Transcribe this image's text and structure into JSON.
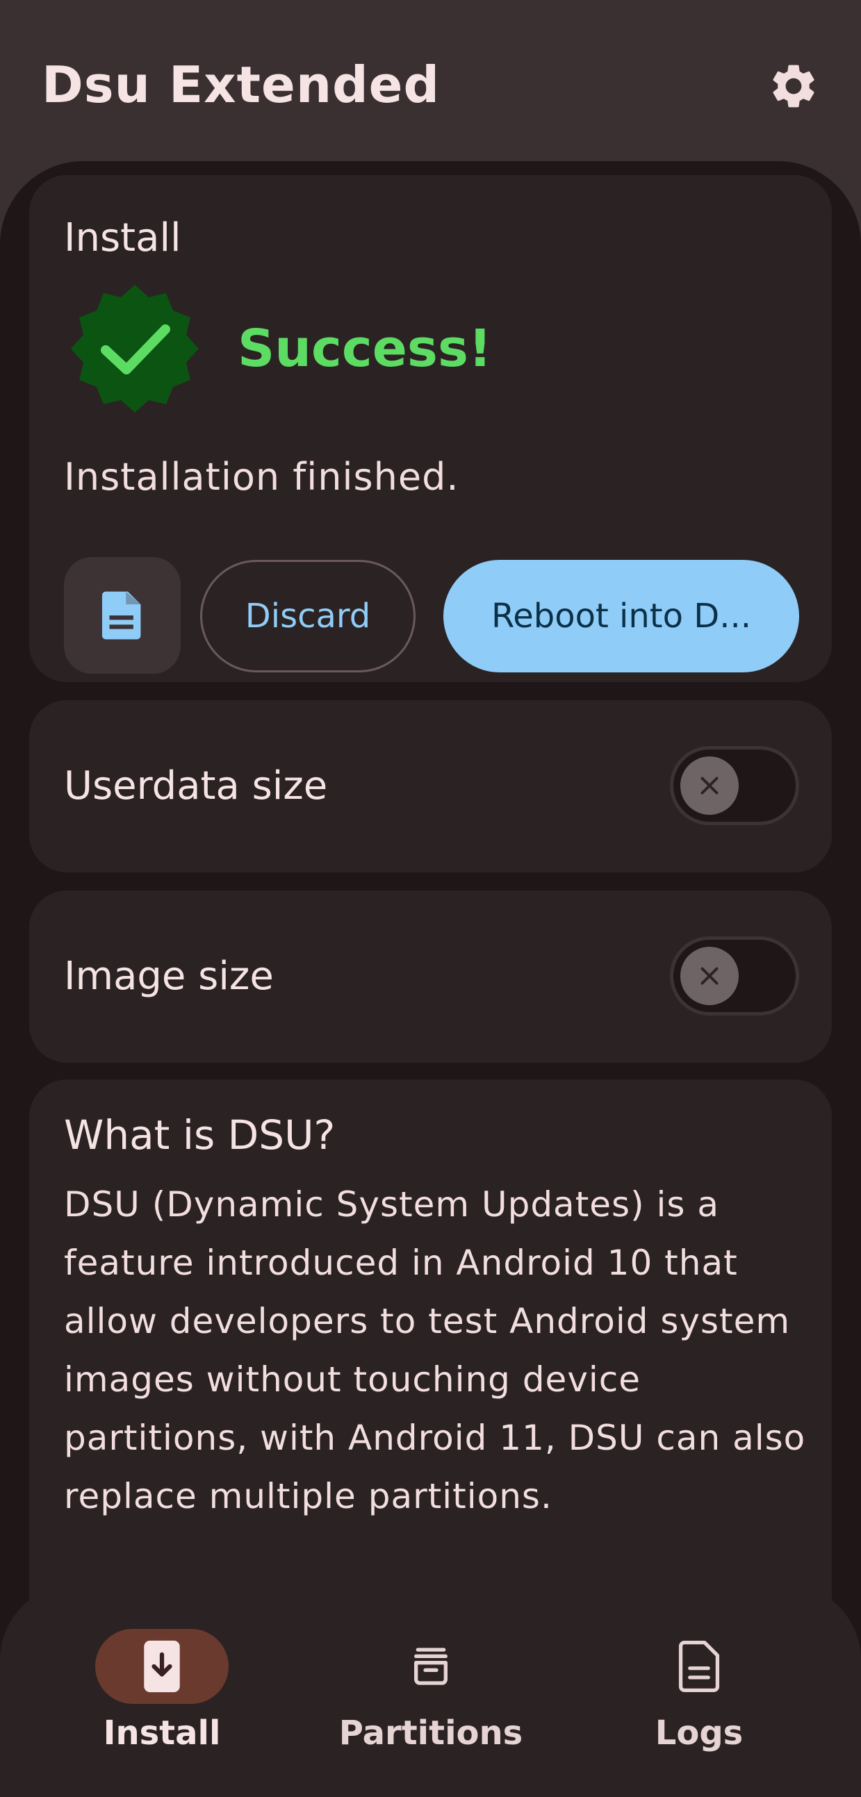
{
  "app_bar": {
    "title": "Dsu Extended",
    "settings_icon": "gear-icon"
  },
  "install_card": {
    "title": "Install",
    "badge_icon": "check-badge-icon",
    "success_text": "Success!",
    "status_text": "Installation finished.",
    "log_icon": "document-icon",
    "discard_label": "Discard",
    "reboot_label": "Reboot into D..."
  },
  "userdata_card": {
    "label": "Userdata size",
    "switch_on": false
  },
  "image_card": {
    "label": "Image size",
    "switch_on": false
  },
  "about_card": {
    "title": "What is DSU?",
    "body": "DSU (Dynamic System Updates) is a feature introduced in Android 10 that allow developers to test Android system images without touching device partitions, with Android 11, DSU can also replace multiple partitions."
  },
  "bottom_nav": {
    "items": [
      {
        "label": "Install",
        "icon": "install-icon",
        "selected": true
      },
      {
        "label": "Partitions",
        "icon": "partitions-icon",
        "selected": false
      },
      {
        "label": "Logs",
        "icon": "logs-icon",
        "selected": false
      }
    ]
  },
  "colors": {
    "success": "#5ddc63",
    "badge": "#0b5412",
    "primary": "#8fcdf8",
    "surface": "#1e1617",
    "card": "#2b2223",
    "nav_selected": "#6b3a2e"
  }
}
